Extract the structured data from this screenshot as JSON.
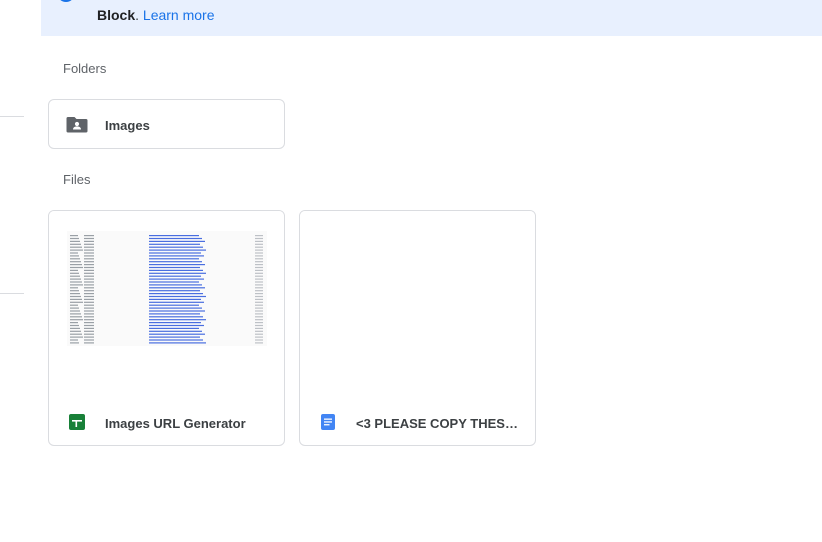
{
  "banner": {
    "text_bold": "Block",
    "text_rest": ". ",
    "link_label": "Learn more"
  },
  "sections": {
    "folders_label": "Folders",
    "files_label": "Files"
  },
  "folders": [
    {
      "name": "Images",
      "icon": "shared-folder-icon"
    }
  ],
  "files": [
    {
      "name": "Images URL Generator",
      "icon": "google-sheets-icon",
      "type": "spreadsheet"
    },
    {
      "name": "<3 PLEASE COPY THESE FI...",
      "icon": "google-docs-icon",
      "type": "document"
    }
  ],
  "colors": {
    "banner_bg": "#e8f0fe",
    "accent_blue": "#1a73e8",
    "sheets_green": "#188038",
    "docs_blue": "#4285f4",
    "border": "#dadce0"
  }
}
